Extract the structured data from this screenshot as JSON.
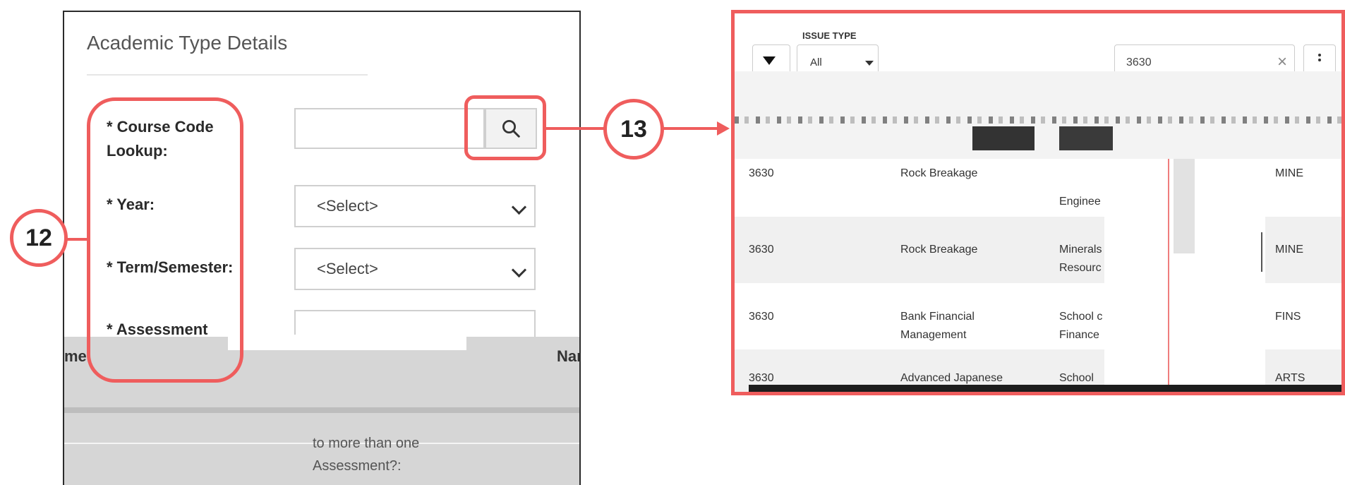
{
  "left_form": {
    "title": "Academic Type Details",
    "course_code_label": "* Course Code Lookup:",
    "year_label": "* Year:",
    "term_label": "* Term/Semester:",
    "assessment_label": "* Assessment",
    "year_value": "<Select>",
    "term_value": "<Select>",
    "fragment_name": "me:",
    "fragment_nar": "Nar",
    "fragment_more": "to more than one Assessment?:"
  },
  "callouts": {
    "left_number": "12",
    "right_number": "13",
    "color": "#ef5d5d"
  },
  "results_panel": {
    "issue_type_label": "ISSUE TYPE",
    "issue_type_value": "All",
    "search_value": "3630",
    "clear_icon": "×",
    "rows": [
      {
        "code": "3630",
        "title": "Rock Breakage",
        "school": "School of Engineering",
        "school_visible": "Enginee",
        "org": "MINE"
      },
      {
        "code": "3630",
        "title": "Rock Breakage",
        "school": "Minerals Resources",
        "school_visible": "Minerals Resourc",
        "org": "MINE"
      },
      {
        "code": "3630",
        "title": "Bank Financial Management",
        "school": "School of Finance",
        "school_visible": "School c Finance",
        "org": "FINS"
      },
      {
        "code": "3630",
        "title": "Advanced Japanese A",
        "school": "School",
        "school_visible": "School",
        "org": "ARTS"
      }
    ]
  }
}
